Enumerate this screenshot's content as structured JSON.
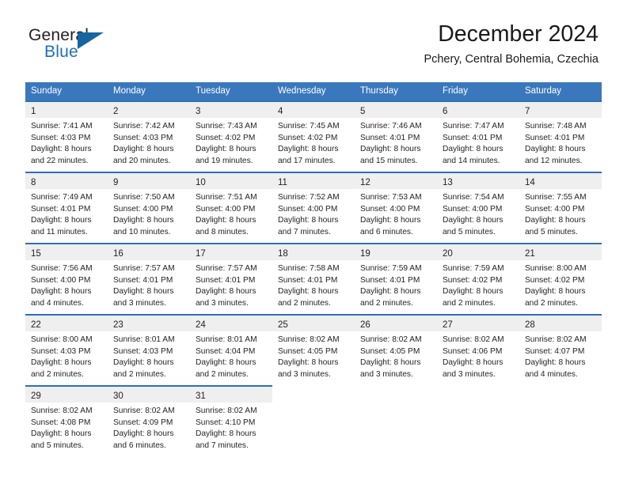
{
  "brand": {
    "name_primary": "General",
    "name_secondary": "Blue",
    "accent_color": "#1c70b8"
  },
  "header": {
    "title": "December 2024",
    "subtitle": "Pchery, Central Bohemia, Czechia"
  },
  "theme": {
    "header_row_bg": "#3a78bd",
    "daynum_band_bg": "#efeff0",
    "week_top_border": "#2f6fb5",
    "text_color": "#231f20"
  },
  "weekdays": [
    "Sunday",
    "Monday",
    "Tuesday",
    "Wednesday",
    "Thursday",
    "Friday",
    "Saturday"
  ],
  "weeks": [
    [
      {
        "day": "1",
        "sunrise": "Sunrise: 7:41 AM",
        "sunset": "Sunset: 4:03 PM",
        "daylight_line1": "Daylight: 8 hours",
        "daylight_line2": "and 22 minutes."
      },
      {
        "day": "2",
        "sunrise": "Sunrise: 7:42 AM",
        "sunset": "Sunset: 4:03 PM",
        "daylight_line1": "Daylight: 8 hours",
        "daylight_line2": "and 20 minutes."
      },
      {
        "day": "3",
        "sunrise": "Sunrise: 7:43 AM",
        "sunset": "Sunset: 4:02 PM",
        "daylight_line1": "Daylight: 8 hours",
        "daylight_line2": "and 19 minutes."
      },
      {
        "day": "4",
        "sunrise": "Sunrise: 7:45 AM",
        "sunset": "Sunset: 4:02 PM",
        "daylight_line1": "Daylight: 8 hours",
        "daylight_line2": "and 17 minutes."
      },
      {
        "day": "5",
        "sunrise": "Sunrise: 7:46 AM",
        "sunset": "Sunset: 4:01 PM",
        "daylight_line1": "Daylight: 8 hours",
        "daylight_line2": "and 15 minutes."
      },
      {
        "day": "6",
        "sunrise": "Sunrise: 7:47 AM",
        "sunset": "Sunset: 4:01 PM",
        "daylight_line1": "Daylight: 8 hours",
        "daylight_line2": "and 14 minutes."
      },
      {
        "day": "7",
        "sunrise": "Sunrise: 7:48 AM",
        "sunset": "Sunset: 4:01 PM",
        "daylight_line1": "Daylight: 8 hours",
        "daylight_line2": "and 12 minutes."
      }
    ],
    [
      {
        "day": "8",
        "sunrise": "Sunrise: 7:49 AM",
        "sunset": "Sunset: 4:01 PM",
        "daylight_line1": "Daylight: 8 hours",
        "daylight_line2": "and 11 minutes."
      },
      {
        "day": "9",
        "sunrise": "Sunrise: 7:50 AM",
        "sunset": "Sunset: 4:00 PM",
        "daylight_line1": "Daylight: 8 hours",
        "daylight_line2": "and 10 minutes."
      },
      {
        "day": "10",
        "sunrise": "Sunrise: 7:51 AM",
        "sunset": "Sunset: 4:00 PM",
        "daylight_line1": "Daylight: 8 hours",
        "daylight_line2": "and 8 minutes."
      },
      {
        "day": "11",
        "sunrise": "Sunrise: 7:52 AM",
        "sunset": "Sunset: 4:00 PM",
        "daylight_line1": "Daylight: 8 hours",
        "daylight_line2": "and 7 minutes."
      },
      {
        "day": "12",
        "sunrise": "Sunrise: 7:53 AM",
        "sunset": "Sunset: 4:00 PM",
        "daylight_line1": "Daylight: 8 hours",
        "daylight_line2": "and 6 minutes."
      },
      {
        "day": "13",
        "sunrise": "Sunrise: 7:54 AM",
        "sunset": "Sunset: 4:00 PM",
        "daylight_line1": "Daylight: 8 hours",
        "daylight_line2": "and 5 minutes."
      },
      {
        "day": "14",
        "sunrise": "Sunrise: 7:55 AM",
        "sunset": "Sunset: 4:00 PM",
        "daylight_line1": "Daylight: 8 hours",
        "daylight_line2": "and 5 minutes."
      }
    ],
    [
      {
        "day": "15",
        "sunrise": "Sunrise: 7:56 AM",
        "sunset": "Sunset: 4:00 PM",
        "daylight_line1": "Daylight: 8 hours",
        "daylight_line2": "and 4 minutes."
      },
      {
        "day": "16",
        "sunrise": "Sunrise: 7:57 AM",
        "sunset": "Sunset: 4:01 PM",
        "daylight_line1": "Daylight: 8 hours",
        "daylight_line2": "and 3 minutes."
      },
      {
        "day": "17",
        "sunrise": "Sunrise: 7:57 AM",
        "sunset": "Sunset: 4:01 PM",
        "daylight_line1": "Daylight: 8 hours",
        "daylight_line2": "and 3 minutes."
      },
      {
        "day": "18",
        "sunrise": "Sunrise: 7:58 AM",
        "sunset": "Sunset: 4:01 PM",
        "daylight_line1": "Daylight: 8 hours",
        "daylight_line2": "and 2 minutes."
      },
      {
        "day": "19",
        "sunrise": "Sunrise: 7:59 AM",
        "sunset": "Sunset: 4:01 PM",
        "daylight_line1": "Daylight: 8 hours",
        "daylight_line2": "and 2 minutes."
      },
      {
        "day": "20",
        "sunrise": "Sunrise: 7:59 AM",
        "sunset": "Sunset: 4:02 PM",
        "daylight_line1": "Daylight: 8 hours",
        "daylight_line2": "and 2 minutes."
      },
      {
        "day": "21",
        "sunrise": "Sunrise: 8:00 AM",
        "sunset": "Sunset: 4:02 PM",
        "daylight_line1": "Daylight: 8 hours",
        "daylight_line2": "and 2 minutes."
      }
    ],
    [
      {
        "day": "22",
        "sunrise": "Sunrise: 8:00 AM",
        "sunset": "Sunset: 4:03 PM",
        "daylight_line1": "Daylight: 8 hours",
        "daylight_line2": "and 2 minutes."
      },
      {
        "day": "23",
        "sunrise": "Sunrise: 8:01 AM",
        "sunset": "Sunset: 4:03 PM",
        "daylight_line1": "Daylight: 8 hours",
        "daylight_line2": "and 2 minutes."
      },
      {
        "day": "24",
        "sunrise": "Sunrise: 8:01 AM",
        "sunset": "Sunset: 4:04 PM",
        "daylight_line1": "Daylight: 8 hours",
        "daylight_line2": "and 2 minutes."
      },
      {
        "day": "25",
        "sunrise": "Sunrise: 8:02 AM",
        "sunset": "Sunset: 4:05 PM",
        "daylight_line1": "Daylight: 8 hours",
        "daylight_line2": "and 3 minutes."
      },
      {
        "day": "26",
        "sunrise": "Sunrise: 8:02 AM",
        "sunset": "Sunset: 4:05 PM",
        "daylight_line1": "Daylight: 8 hours",
        "daylight_line2": "and 3 minutes."
      },
      {
        "day": "27",
        "sunrise": "Sunrise: 8:02 AM",
        "sunset": "Sunset: 4:06 PM",
        "daylight_line1": "Daylight: 8 hours",
        "daylight_line2": "and 3 minutes."
      },
      {
        "day": "28",
        "sunrise": "Sunrise: 8:02 AM",
        "sunset": "Sunset: 4:07 PM",
        "daylight_line1": "Daylight: 8 hours",
        "daylight_line2": "and 4 minutes."
      }
    ],
    [
      {
        "day": "29",
        "sunrise": "Sunrise: 8:02 AM",
        "sunset": "Sunset: 4:08 PM",
        "daylight_line1": "Daylight: 8 hours",
        "daylight_line2": "and 5 minutes."
      },
      {
        "day": "30",
        "sunrise": "Sunrise: 8:02 AM",
        "sunset": "Sunset: 4:09 PM",
        "daylight_line1": "Daylight: 8 hours",
        "daylight_line2": "and 6 minutes."
      },
      {
        "day": "31",
        "sunrise": "Sunrise: 8:02 AM",
        "sunset": "Sunset: 4:10 PM",
        "daylight_line1": "Daylight: 8 hours",
        "daylight_line2": "and 7 minutes."
      },
      {
        "day": "",
        "sunrise": "",
        "sunset": "",
        "daylight_line1": "",
        "daylight_line2": ""
      },
      {
        "day": "",
        "sunrise": "",
        "sunset": "",
        "daylight_line1": "",
        "daylight_line2": ""
      },
      {
        "day": "",
        "sunrise": "",
        "sunset": "",
        "daylight_line1": "",
        "daylight_line2": ""
      },
      {
        "day": "",
        "sunrise": "",
        "sunset": "",
        "daylight_line1": "",
        "daylight_line2": ""
      }
    ]
  ]
}
